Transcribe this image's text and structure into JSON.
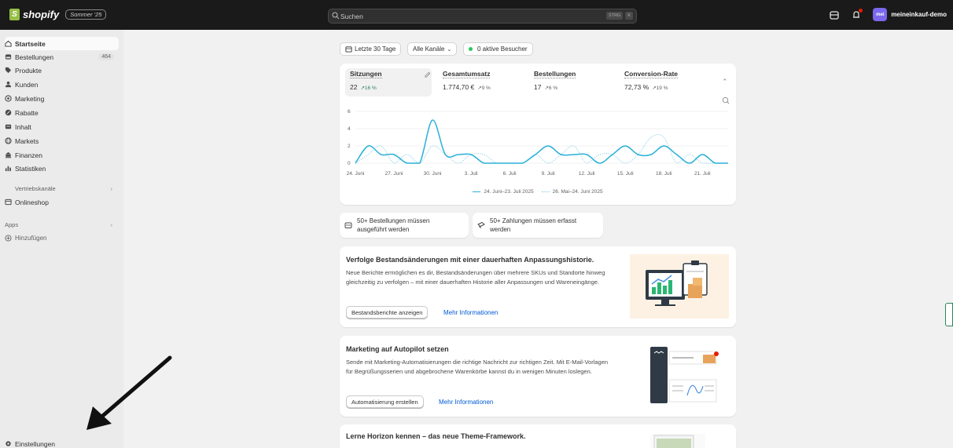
{
  "topbar": {
    "logo_text": "shopify",
    "edition": "Sommer '25",
    "search_placeholder": "Suchen",
    "shortcut_1": "STRG",
    "shortcut_2": "K",
    "avatar_initials": "mei",
    "store_name": "meineinkauf-demo"
  },
  "sidebar": {
    "items": [
      {
        "label": "Startseite",
        "icon": "home-icon"
      },
      {
        "label": "Bestellungen",
        "icon": "inbox-icon",
        "badge": "464"
      },
      {
        "label": "Produkte",
        "icon": "tag-icon"
      },
      {
        "label": "Kunden",
        "icon": "person-icon"
      },
      {
        "label": "Marketing",
        "icon": "target-icon"
      },
      {
        "label": "Rabatte",
        "icon": "discount-icon"
      },
      {
        "label": "Inhalt",
        "icon": "content-icon"
      },
      {
        "label": "Markets",
        "icon": "globe-icon"
      },
      {
        "label": "Finanzen",
        "icon": "bank-icon"
      },
      {
        "label": "Statistiken",
        "icon": "bar-chart-icon"
      }
    ],
    "sales_channels": "Vertriebskanäle",
    "online_store": "Onlineshop",
    "apps": "Apps",
    "add": "Hinzufügen",
    "settings": "Einstellungen"
  },
  "filters": {
    "period": "Letzte 30 Tage",
    "channels": "Alle Kanäle",
    "visitors": "0 aktive Besucher"
  },
  "metrics": [
    {
      "label": "Sitzungen",
      "value": "22",
      "change": "16 %"
    },
    {
      "label": "Gesamtumsatz",
      "value": "1.774,70 €",
      "change": "9 %"
    },
    {
      "label": "Bestellungen",
      "value": "17",
      "change": "6 %"
    },
    {
      "label": "Conversion-Rate",
      "value": "72,73 %",
      "change": "19 %"
    }
  ],
  "chart_data": {
    "type": "line",
    "x": [
      "24. Juni",
      "25. Juni",
      "26. Juni",
      "27. Juni",
      "28. Juni",
      "29. Juni",
      "30. Juni",
      "1. Juli",
      "2. Juli",
      "3. Juli",
      "4. Juli",
      "5. Juli",
      "6. Juli",
      "7. Juli",
      "8. Juli",
      "9. Juli",
      "10. Juli",
      "11. Juli",
      "12. Juli",
      "13. Juli",
      "14. Juli",
      "15. Juli",
      "16. Juli",
      "17. Juli",
      "18. Juli",
      "19. Juli",
      "20. Juli",
      "21. Juli",
      "22. Juli",
      "23. Juli"
    ],
    "x_ticks": [
      "24. Juni",
      "27. Juni",
      "30. Juni",
      "3. Juli",
      "6. Juli",
      "9. Juli",
      "12. Juli",
      "15. Juli",
      "18. Juli",
      "21. Juli"
    ],
    "y_ticks": [
      "0",
      "2",
      "4",
      "6"
    ],
    "ylim": [
      0,
      6
    ],
    "series": [
      {
        "name": "24. Juni–23. Juli 2025",
        "style": "solid",
        "color": "#2ab0d8",
        "values": [
          0,
          2,
          1,
          1,
          0,
          0,
          5,
          1,
          1,
          1,
          0,
          0,
          0,
          0,
          1,
          2,
          1,
          1,
          1,
          0,
          1,
          2,
          1,
          1,
          2,
          1,
          0,
          1,
          0,
          0
        ]
      },
      {
        "name": "26. Mai–24. Juni 2025",
        "style": "dotted",
        "color": "#7fcde6",
        "values": [
          0,
          1,
          2,
          0,
          1,
          0,
          2,
          1,
          0,
          1,
          1,
          0,
          0,
          0,
          1,
          0,
          1,
          2,
          0,
          1,
          1,
          0,
          1,
          3,
          3,
          0,
          1,
          0,
          0,
          0
        ]
      }
    ]
  },
  "tasks": [
    {
      "label": "50+ Bestellungen müssen ausgeführt werden",
      "icon": "order-icon"
    },
    {
      "label": "50+ Zahlungen müssen erfasst werden",
      "icon": "payment-icon"
    }
  ],
  "promos": [
    {
      "title": "Verfolge Bestandsänderungen mit einer dauerhaften Anpassungshistorie.",
      "text": "Neue Berichte ermöglichen es dir, Bestandsänderungen über mehrere SKUs und Standorte hinweg gleichzeitig zu verfolgen – mit einer dauerhaften Historie aller Anpassungen und Wareneingänge.",
      "button": "Bestandsberichte anzeigen",
      "link": "Mehr Informationen"
    },
    {
      "title": "Marketing auf Autopilot setzen",
      "text": "Sende mit Marketing-Automatisierungen die richtige Nachricht zur richtigen Zeit. Mit E-Mail-Vorlagen für Begrüßungsserien und abgebrochene Warenkörbe kannst du in wenigen Minuten loslegen.",
      "button": "Automatisierung erstellen",
      "link": "Mehr Informationen"
    },
    {
      "title": "Lerne Horizon kennen – das neue Theme-Framework."
    }
  ]
}
